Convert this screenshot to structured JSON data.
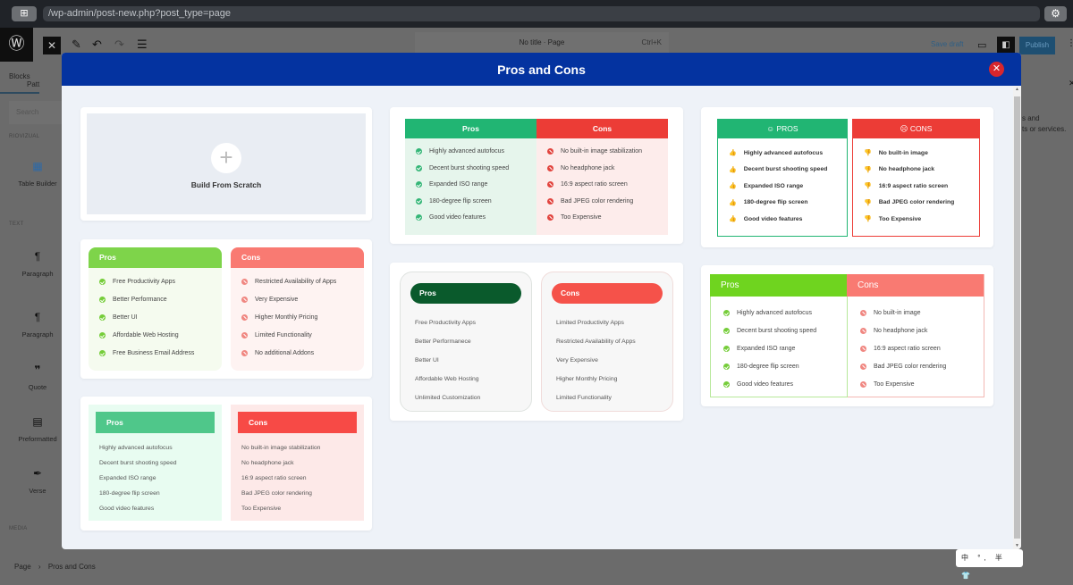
{
  "browser": {
    "url": "/wp-admin/post-new.php?post_type=page",
    "tab_icon": "grid-icon",
    "settings_icon": "gear-icon"
  },
  "editor_toolbar": {
    "close_label": "✕",
    "doc_title": "No title · Page",
    "shortcut": "Ctrl+K",
    "save_draft": "Save draft",
    "publish": "Publish"
  },
  "left_panel": {
    "tabs": [
      "Blocks",
      "Patt"
    ],
    "search_placeholder": "Search",
    "sections": {
      "riovizual": "RIOVIZUAL",
      "text": "TEXT",
      "media": "MEDIA"
    },
    "blocks": [
      {
        "label": "Table Builder",
        "icon": "table-icon"
      },
      {
        "label": "Paragraph",
        "icon": "paragraph-icon"
      },
      {
        "label": "Paragraph",
        "icon": "paragraph-icon"
      },
      {
        "label": "Quote",
        "icon": "quote-icon"
      },
      {
        "label": "Preformatted",
        "icon": "preformatted-icon"
      },
      {
        "label": "Verse",
        "icon": "verse-icon"
      }
    ]
  },
  "right_panel": {
    "text_line1": "s and",
    "text_line2": "ts or services."
  },
  "breadcrumb": {
    "root": "Page",
    "separator": "›",
    "current": "Pros and Cons"
  },
  "modal": {
    "title": "Pros and Cons",
    "close_icon": "close-icon",
    "scratch_label": "Build From Scratch",
    "templates": [
      {
        "id": "t1",
        "pros_title": "Pros",
        "cons_title": "Cons",
        "pros": [
          "Highly advanced autofocus",
          "Decent burst shooting speed",
          "Expanded ISO range",
          "180-degree flip screen",
          "Good video features"
        ],
        "cons": [
          "No built-in image stabilization",
          "No headphone jack",
          "16:9 aspect ratio screen",
          "Bad JPEG color rendering",
          "Too Expensive"
        ],
        "pros_color": "#21b573",
        "cons_color": "#ec3c36"
      },
      {
        "id": "t2",
        "pros_title": "PROS",
        "cons_title": "CONS",
        "pros": [
          "Highly advanced autofocus",
          "Decent burst shooting speed",
          "Expanded ISO range",
          "180-degree flip screen",
          "Good video features"
        ],
        "cons": [
          "No built-in image",
          "No headphone jack",
          "16:9 aspect ratio screen",
          "Bad JPEG color rendering",
          "Too Expensive"
        ],
        "pros_color": "#21b573",
        "cons_color": "#ec3c36"
      },
      {
        "id": "t3",
        "pros_title": "Pros",
        "cons_title": "Cons",
        "pros": [
          "Free Productivity Apps",
          "Better Performance",
          "Better UI",
          "Affordable Web Hosting",
          "Free Business Email Address"
        ],
        "cons": [
          "Restricted Availability of Apps",
          "Very Expensive",
          "Higher Monthly Pricing",
          "Limited Functionality",
          "No additional Addons"
        ],
        "pros_color": "#7ed44a",
        "cons_color": "#f97a72"
      },
      {
        "id": "t4",
        "pros_title": "Pros",
        "cons_title": "Cons",
        "pros": [
          "Free Productivity Apps",
          "Better Performanece",
          "Better UI",
          "Affordable Web Hosting",
          "Unlimited Customization"
        ],
        "cons": [
          "Limited Productivity Apps",
          "Restricted Availability of Apps",
          "Very Expensive",
          "Higher Monthly Pricing",
          "Limited Functionality"
        ],
        "pros_color": "#0a5a2c",
        "cons_color": "#f5524a"
      },
      {
        "id": "t5",
        "pros_title": "Pros",
        "cons_title": "Cons",
        "pros": [
          "Highly advanced autofocus",
          "Decent burst shooting speed",
          "Expanded ISO range",
          "180-degree flip screen",
          "Good video features"
        ],
        "cons": [
          "No built-in image",
          "No headphone jack",
          "16:9 aspect ratio screen",
          "Bad JPEG color rendering",
          "Too Expensive"
        ],
        "pros_color": "#6fd41f",
        "cons_color": "#f97a72"
      },
      {
        "id": "t6",
        "pros_title": "Pros",
        "cons_title": "Cons",
        "pros": [
          "Highly advanced autofocus",
          "Decent burst shooting speed",
          "Expanded ISO range",
          "180-degree flip screen",
          "Good video features"
        ],
        "cons": [
          "No built-in image stabilization",
          "No headphone jack",
          "16:9 aspect ratio screen",
          "Bad JPEG color rendering",
          "Too Expensive"
        ],
        "pros_color": "#4fc78a",
        "cons_color": "#f74a46"
      }
    ]
  },
  "ime_bar": {
    "text": "中 °, 半 👕"
  }
}
